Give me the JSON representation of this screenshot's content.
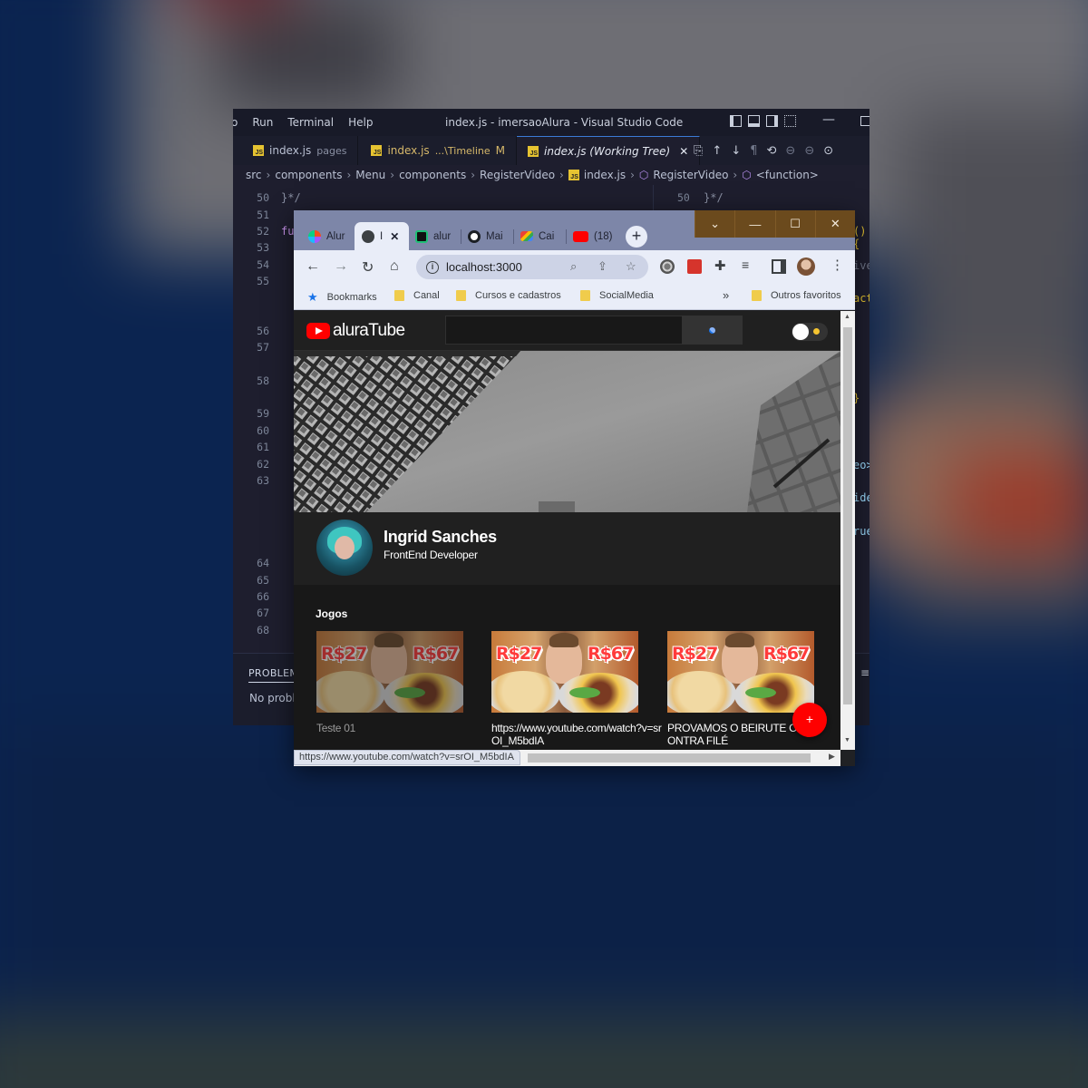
{
  "colors": {
    "desktop": "#0a2350",
    "vscode_bg": "#1e1e2e",
    "chrome_frame": "#7d86a8",
    "chrome_toolbar": "#e9edf8",
    "page_bg": "#181818",
    "header_bg": "#202020",
    "accent_red": "#ff0000"
  },
  "vscode": {
    "menu": [
      "Run",
      "Terminal",
      "Help"
    ],
    "window_title": "index.js - imersaoAlura - Visual Studio Code",
    "tabs": [
      {
        "label": "index.js",
        "detail": "pages",
        "modified": ""
      },
      {
        "label": "index.js",
        "detail": "...\\Timeline",
        "modified": "M"
      },
      {
        "label": "index.js (Working Tree)",
        "detail": "",
        "modified": ""
      }
    ],
    "breadcrumb": [
      "src",
      "components",
      "Menu",
      "components",
      "RegisterVideo",
      "index.js",
      "RegisterVideo",
      "<function>"
    ],
    "line_numbers_left": [
      "50",
      "51",
      "52",
      "53",
      "54",
      "55",
      "56",
      "57",
      "58",
      "59",
      "60",
      "61",
      "62",
      "63",
      "64",
      "65",
      "66",
      "67",
      "68"
    ],
    "line_number_right": "50",
    "code_left": "}*/",
    "code_left_fn": "fu",
    "code_right": "}*/",
    "code_fragments_right": [
      "(){",
      "ive",
      "act",
      "}",
      "eo>",
      "ide",
      "rue"
    ],
    "panel_tab": "PROBLEMS",
    "panel_message": "No probl",
    "layout_icons": [
      "layout-sidebar-icon",
      "layout-panel-icon",
      "layout-split-icon",
      "layout-grid-icon"
    ]
  },
  "chrome": {
    "tabs": [
      {
        "label": "Alur",
        "favicon": "figma-icon"
      },
      {
        "label": "I",
        "favicon": "globe-icon"
      },
      {
        "label": "alur",
        "favicon": "vercel-icon"
      },
      {
        "label": "Mai",
        "favicon": "github-icon"
      },
      {
        "label": "Cai",
        "favicon": "gmail-icon"
      },
      {
        "label": "(18)",
        "favicon": "youtube-icon"
      }
    ],
    "url": "localhost:3000",
    "bookmarks": {
      "bar_label": "Bookmarks",
      "items": [
        "Canal",
        "Cursos e cadastros",
        "SocialMedia"
      ],
      "overflow": "»",
      "other": "Outros favoritos"
    },
    "status_url": "https://www.youtube.com/watch?v=srOI_M5bdIA"
  },
  "page": {
    "logo_text": "aluraTube",
    "search_placeholder": "",
    "profile": {
      "name": "Ingrid Sanches",
      "job": "FrontEnd Developer"
    },
    "section_title": "Jogos",
    "videos": [
      {
        "title": "Teste 01",
        "price_left": "R$27",
        "price_right": "R$67"
      },
      {
        "title": "https://www.youtube.com/watch?v=srOI_M5bdIA",
        "price_left": "R$27",
        "price_right": "R$67"
      },
      {
        "title": "PROVAMOS O BEIRUTE CONTRA FILÉ",
        "price_left": "R$27",
        "price_right": "R$67"
      }
    ],
    "fab_label": "+"
  }
}
